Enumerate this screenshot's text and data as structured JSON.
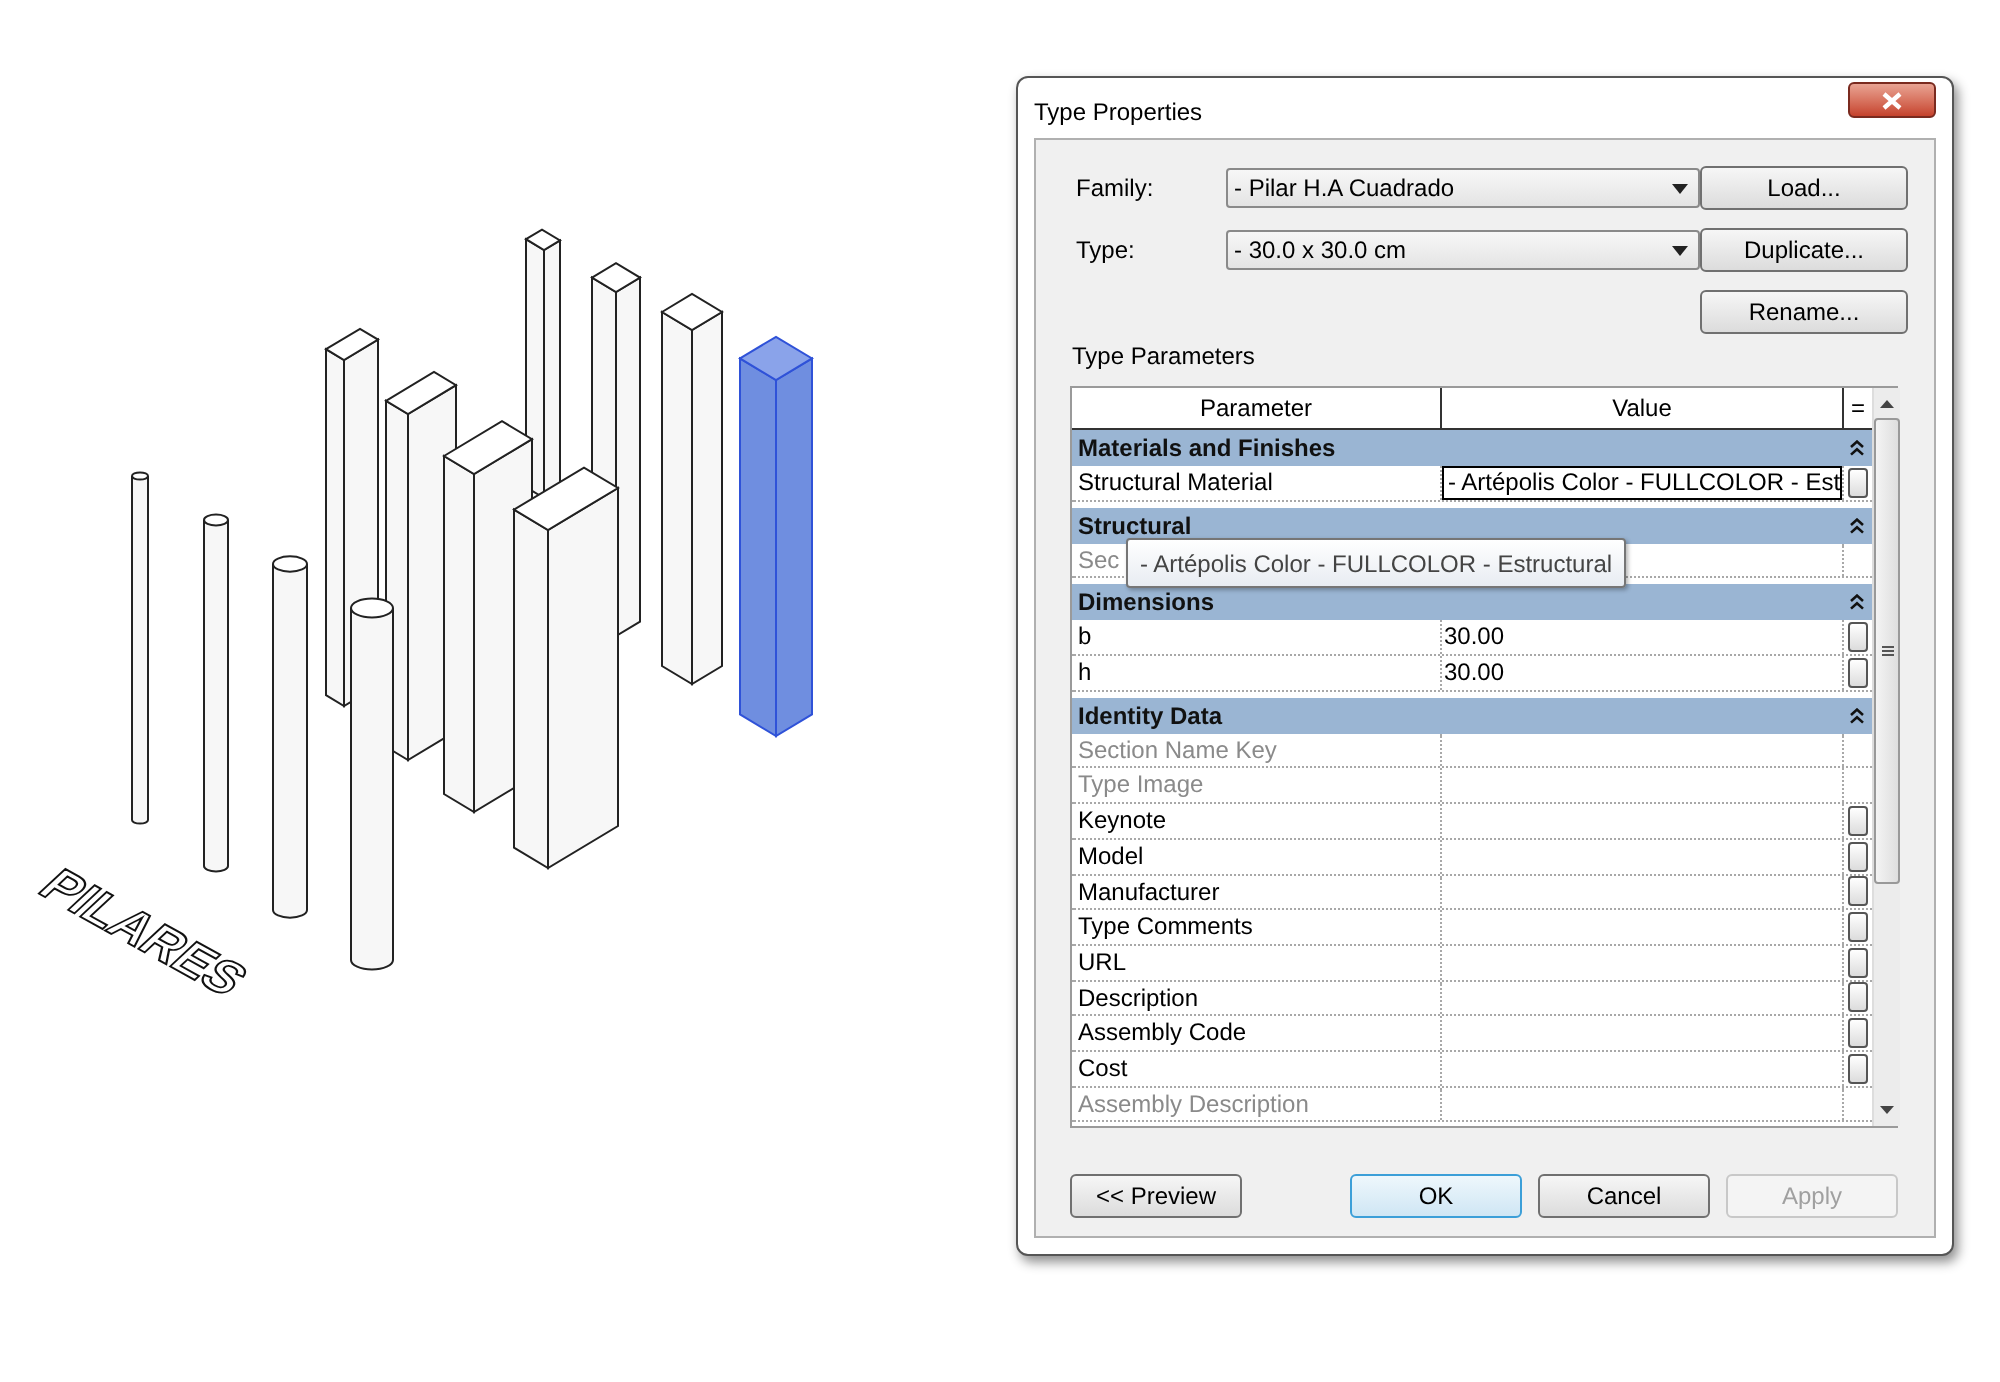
{
  "model_view": {
    "label": "PILARES",
    "pillars": [
      {
        "kind": "square",
        "selected": false
      },
      {
        "kind": "square",
        "selected": false
      },
      {
        "kind": "square",
        "selected": false
      },
      {
        "kind": "square",
        "selected": true
      },
      {
        "kind": "square",
        "selected": false
      },
      {
        "kind": "square",
        "selected": false
      },
      {
        "kind": "square",
        "selected": false
      },
      {
        "kind": "square",
        "selected": false
      },
      {
        "kind": "round",
        "selected": false
      },
      {
        "kind": "round",
        "selected": false
      },
      {
        "kind": "round",
        "selected": false
      },
      {
        "kind": "round",
        "selected": false
      }
    ]
  },
  "dialog": {
    "title": "Type Properties",
    "family": {
      "label": "Family:",
      "value": "- Pilar H.A Cuadrado"
    },
    "type": {
      "label": "Type:",
      "value": "- 30.0 x 30.0 cm"
    },
    "side_buttons": [
      "Load...",
      "Duplicate...",
      "Rename..."
    ],
    "section_label": "Type Parameters",
    "table": {
      "columns": [
        "Parameter",
        "Value",
        "="
      ],
      "rows": [
        {
          "kind": "group",
          "name": "Materials and Finishes"
        },
        {
          "kind": "param",
          "name": "Structural Material",
          "value": "- Artépolis Color - FULLCOLOR - Est",
          "disabled": false,
          "editing": true,
          "button": true
        },
        {
          "kind": "group",
          "name": "Structural"
        },
        {
          "kind": "param",
          "name": "Sec",
          "value": "",
          "disabled": true,
          "editing": false,
          "button": false
        },
        {
          "kind": "group",
          "name": "Dimensions"
        },
        {
          "kind": "param",
          "name": "b",
          "value": "30.00",
          "disabled": false,
          "editing": false,
          "button": true
        },
        {
          "kind": "param",
          "name": "h",
          "value": "30.00",
          "disabled": false,
          "editing": false,
          "button": true
        },
        {
          "kind": "group",
          "name": "Identity Data"
        },
        {
          "kind": "param",
          "name": "Section Name Key",
          "value": "",
          "disabled": true,
          "editing": false,
          "button": false
        },
        {
          "kind": "param",
          "name": "Type Image",
          "value": "",
          "disabled": true,
          "editing": false,
          "button": false
        },
        {
          "kind": "param",
          "name": "Keynote",
          "value": "",
          "disabled": false,
          "editing": false,
          "button": true
        },
        {
          "kind": "param",
          "name": "Model",
          "value": "",
          "disabled": false,
          "editing": false,
          "button": true
        },
        {
          "kind": "param",
          "name": "Manufacturer",
          "value": "",
          "disabled": false,
          "editing": false,
          "button": true
        },
        {
          "kind": "param",
          "name": "Type Comments",
          "value": "",
          "disabled": false,
          "editing": false,
          "button": true
        },
        {
          "kind": "param",
          "name": "URL",
          "value": "",
          "disabled": false,
          "editing": false,
          "button": true
        },
        {
          "kind": "param",
          "name": "Description",
          "value": "",
          "disabled": false,
          "editing": false,
          "button": true
        },
        {
          "kind": "param",
          "name": "Assembly Code",
          "value": "",
          "disabled": false,
          "editing": false,
          "button": true
        },
        {
          "kind": "param",
          "name": "Cost",
          "value": "",
          "disabled": false,
          "editing": false,
          "button": true
        },
        {
          "kind": "param",
          "name": "Assembly Description",
          "value": "",
          "disabled": true,
          "editing": false,
          "button": false
        }
      ]
    },
    "tooltip": "- Artépolis Color - FULLCOLOR - Estructural",
    "footer_buttons": [
      {
        "label": "<< Preview",
        "kind": "normal",
        "disabled": false
      },
      {
        "label": "OK",
        "kind": "default",
        "disabled": false
      },
      {
        "label": "Cancel",
        "kind": "normal",
        "disabled": false
      },
      {
        "label": "Apply",
        "kind": "normal",
        "disabled": true
      }
    ]
  }
}
